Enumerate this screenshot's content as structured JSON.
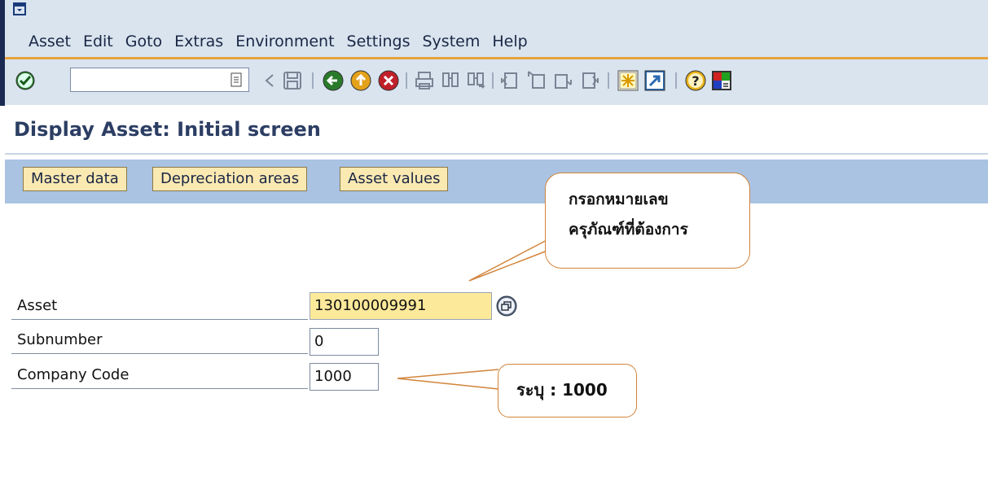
{
  "menu": {
    "items": [
      {
        "label": "Asset",
        "key": "t"
      },
      {
        "label": "Edit"
      },
      {
        "label": "Goto"
      },
      {
        "label": "Extras"
      },
      {
        "label": "Environment"
      },
      {
        "label": "Settings"
      },
      {
        "label": "System"
      },
      {
        "label": "Help"
      }
    ]
  },
  "toolbar": {
    "command_field_value": ""
  },
  "title": "Display Asset: Initial screen",
  "app_toolbar": {
    "buttons": [
      "Master data",
      "Depreciation areas",
      "Asset values"
    ]
  },
  "form": {
    "asset_label": "Asset",
    "asset_value": "130100009991",
    "subnumber_label": "Subnumber",
    "subnumber_value": "0",
    "company_code_label": "Company Code",
    "company_code_value": "1000"
  },
  "callouts": {
    "asset_note_line1": "กรอกหมายเลข",
    "asset_note_line2": "ครุภัณฑ์ที่ต้องการ",
    "company_note": "ระบุ : 1000"
  },
  "colors": {
    "menu_bg": "#d9e4ef",
    "app_toolbar_bg": "#aac3e3",
    "button_bg": "#fbe9b2",
    "required_field_bg": "#fde99a",
    "callout_border": "#d2843a",
    "title_color": "#2c3e63"
  }
}
